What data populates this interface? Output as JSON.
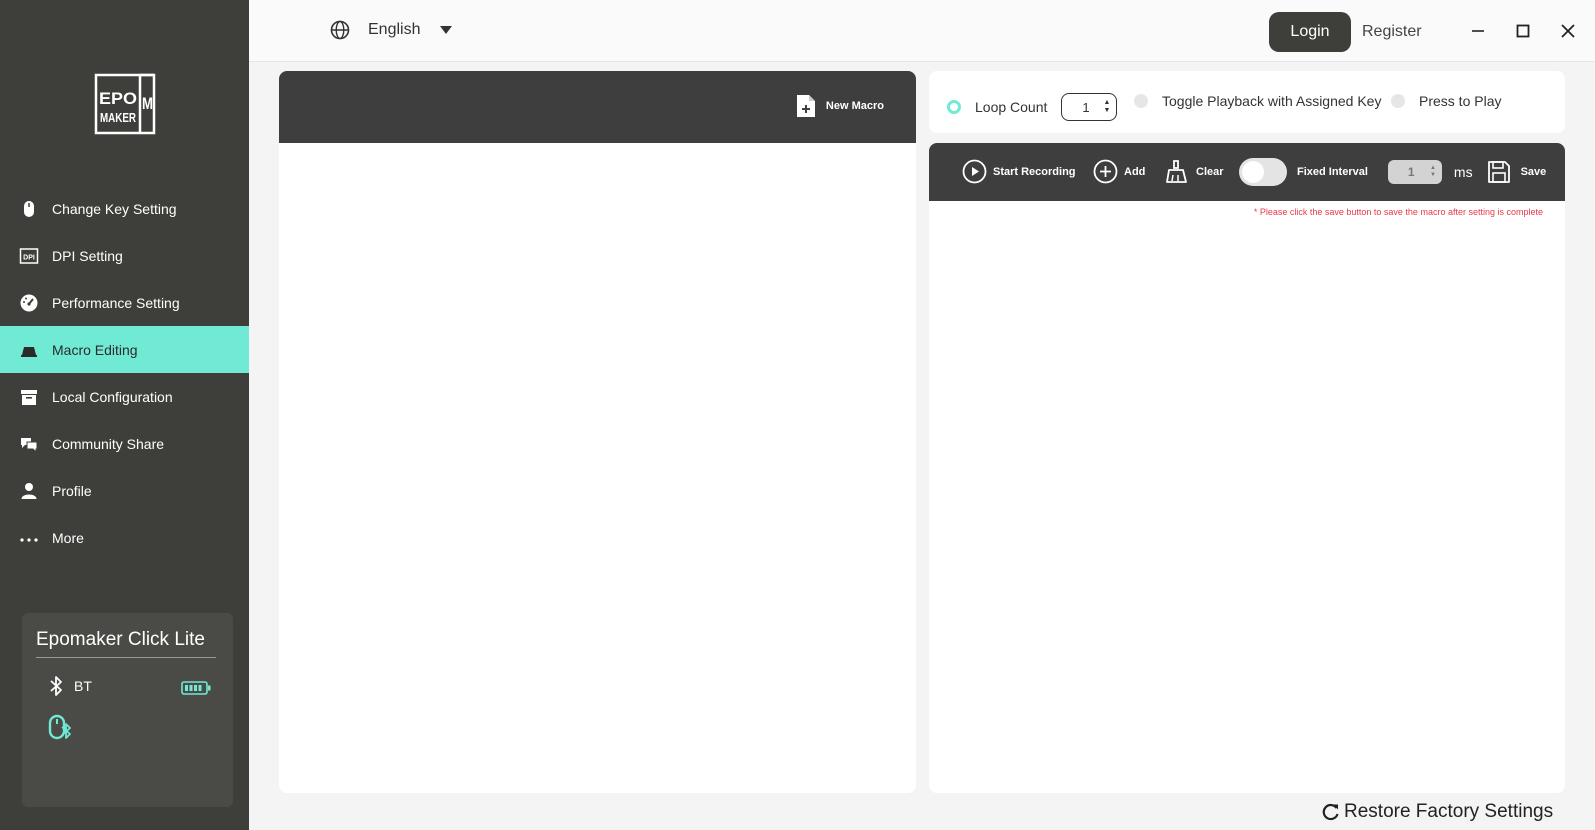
{
  "brand": {
    "logo_text": "EPOM MAKER"
  },
  "sidebar": {
    "items": [
      {
        "label": "Change Key Setting",
        "icon": "mouse-icon"
      },
      {
        "label": "DPI Setting",
        "icon": "dpi-icon"
      },
      {
        "label": "Performance Setting",
        "icon": "speedometer-icon"
      },
      {
        "label": "Macro Editing",
        "icon": "keyboard-icon",
        "active": true
      },
      {
        "label": "Local Configuration",
        "icon": "archive-icon"
      },
      {
        "label": "Community Share",
        "icon": "chat-icon"
      },
      {
        "label": "Profile",
        "icon": "user-icon"
      },
      {
        "label": "More",
        "icon": "more-icon"
      }
    ]
  },
  "device": {
    "name": "Epomaker Click Lite",
    "connection": "BT",
    "connection_icon": "bluetooth-icon",
    "battery_icon": "battery-full-icon",
    "status_icon": "mouse-bluetooth-icon"
  },
  "topbar": {
    "language": "English",
    "login_label": "Login",
    "register_label": "Register"
  },
  "macro_list": {
    "new_macro_label": "New Macro"
  },
  "playback": {
    "loop_count_label": "Loop Count",
    "loop_count_value": "1",
    "toggle_label": "Toggle Playback with Assigned Key",
    "press_label": "Press to Play",
    "selected": "loop_count"
  },
  "editor": {
    "start_recording_label": "Start Recording",
    "add_label": "Add",
    "clear_label": "Clear",
    "fixed_interval_label": "Fixed Interval",
    "fixed_interval_on": false,
    "interval_value": "1",
    "interval_unit": "ms",
    "save_label": "Save",
    "notice": "* Please click the save button to save the macro after setting is complete"
  },
  "footer": {
    "restore_label": "Restore Factory Settings"
  },
  "colors": {
    "sidebar_bg": "#3e3f3a",
    "accent": "#71ead5",
    "dark_bar": "#3e3e3e",
    "warning": "#e8394a"
  }
}
